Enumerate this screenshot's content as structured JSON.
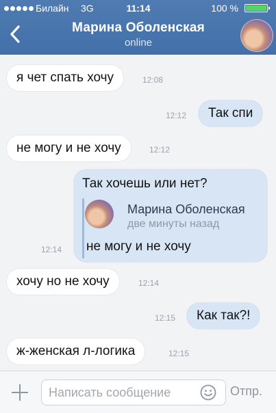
{
  "status_bar": {
    "carrier": "Билайн",
    "network": "3G",
    "time": "11:14",
    "battery_percent": "100 %",
    "battery_level": 1.0
  },
  "navbar": {
    "title": "Марина Оболенская",
    "subtitle": "online"
  },
  "messages": [
    {
      "direction": "in",
      "text": "я чет спать хочу",
      "time": "12:08"
    },
    {
      "direction": "out",
      "text": "Так спи",
      "time": "12:12"
    },
    {
      "direction": "in",
      "text": "не могу и не хочу",
      "time": "12:12"
    },
    {
      "direction": "out",
      "text": "Так хочешь или нет?",
      "time": "12:14",
      "forwarded": {
        "author": "Марина Оболенская",
        "date": "две минуты назад",
        "text": "не могу и не хочу"
      }
    },
    {
      "direction": "in",
      "text": "хочу но не хочу",
      "time": "12:14"
    },
    {
      "direction": "out",
      "text": "Как так?!",
      "time": "12:15"
    },
    {
      "direction": "in",
      "text": "ж-женская л-логика",
      "time": "12:15"
    }
  ],
  "input_bar": {
    "placeholder": "Написать сообщение",
    "send_label": "Отпр."
  },
  "colors": {
    "header": "#4a76ae",
    "incoming_bubble": "#ffffff",
    "outgoing_bubble": "#d7e5f5",
    "battery_fill": "#58d36a"
  },
  "icons": [
    "back-chevron-icon",
    "battery-icon",
    "signal-dots-icon",
    "plus-icon",
    "emoji-icon"
  ]
}
